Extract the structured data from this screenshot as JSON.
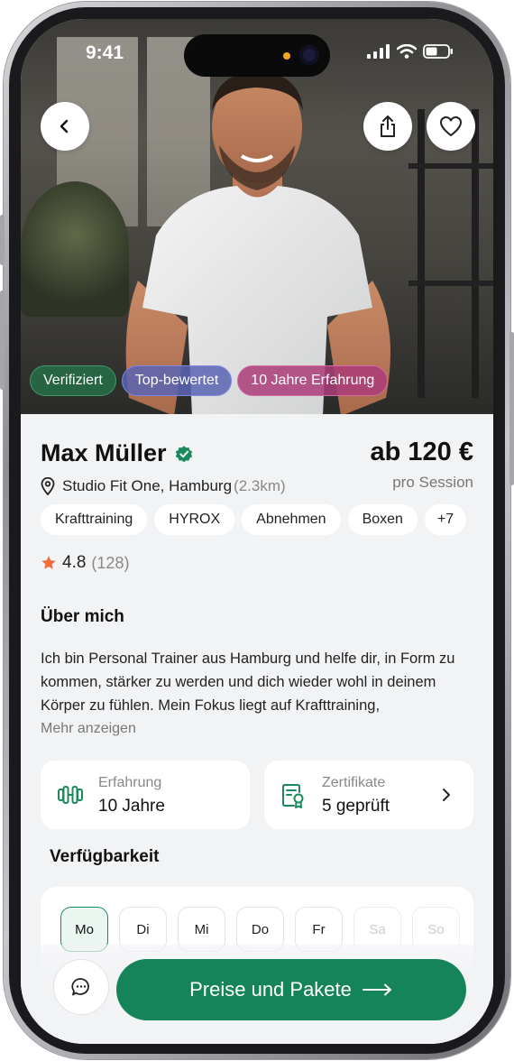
{
  "status_bar": {
    "time": "9:41"
  },
  "hero": {
    "badges": [
      "Verifiziert",
      "Top-bewertet",
      "10 Jahre Erfahrung"
    ]
  },
  "trainer": {
    "name": "Max Müller",
    "price": "ab 120 €",
    "price_unit": "pro Session",
    "location": "Studio Fit One, Hamburg",
    "distance": "(2.3km)",
    "tags": [
      "Krafttraining",
      "HYROX",
      "Abnehmen",
      "Boxen",
      "+7"
    ],
    "rating": "4.8",
    "rating_count": "(128)"
  },
  "about": {
    "title": "Über mich",
    "text": "Ich bin Personal Trainer aus Hamburg und helfe dir, in Form zu kommen, stärker zu werden und dich wieder wohl in deinem Körper zu fühlen. Mein Fokus liegt auf Krafttraining,",
    "more_label": "Mehr anzeigen"
  },
  "stats": {
    "experience_label": "Erfahrung",
    "experience_value": "10 Jahre",
    "certs_label": "Zertifikate",
    "certs_value": "5 geprüft"
  },
  "availability": {
    "title": "Verfügbarkeit",
    "days": [
      "Mo",
      "Di",
      "Mi",
      "Do",
      "Fr",
      "Sa",
      "So"
    ]
  },
  "cta": {
    "label": "Preise und Pakete"
  },
  "colors": {
    "accent": "#16845a",
    "star": "#f26b3a"
  }
}
